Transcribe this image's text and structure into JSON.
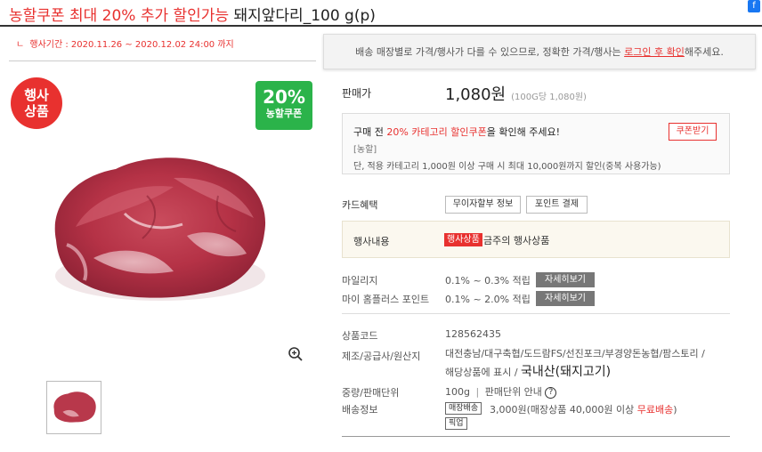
{
  "header": {
    "promo_text": "농할쿠폰 최대 20% 추가 할인가능",
    "product_name": "돼지앞다리_100 g(p)",
    "share_icon": "facebook-icon"
  },
  "period": {
    "bullet": "ㄴ",
    "text": "행사기간 : 2020.11.26 ~ 2020.12.02 24:00 까지"
  },
  "notice": {
    "text_before": "배송 매장별로 가격/행사가 다를 수 있으므로, 정확한 가격/행사는 ",
    "link": "로그인 후 확인",
    "text_after": "해주세요."
  },
  "badges": {
    "event_line1": "행사",
    "event_line2": "상품",
    "coupon_pct": "20%",
    "coupon_label": "농할쿠폰"
  },
  "gallery": {
    "zoom_icon": "zoom-in-icon"
  },
  "price": {
    "label": "판매가",
    "value": "1,080원",
    "unit": "(100G당 1,080원)"
  },
  "coupon": {
    "title_before": "구매 전 ",
    "title_red": "20% 카테고리 할인쿠폰",
    "title_after": "을 확인해 주세요!",
    "sub": "[농할]",
    "desc": "단, 적용 카테고리 1,000원 이상 구매 시 최대 10,000원까지 할인(중복 사용가능)",
    "button": "쿠폰받기"
  },
  "card": {
    "label": "카드혜택",
    "btn_installment": "무이자할부 정보",
    "btn_point": "포인트 결제"
  },
  "event": {
    "label": "행사내용",
    "tag": "행사상품",
    "text": "금주의 행사상품"
  },
  "points": {
    "mileage_label": "마일리지",
    "mileage_value": "0.1% ~ 0.3% 적립",
    "plus_label": "마이 홈플러스 포인트",
    "plus_value": "0.1% ~ 2.0% 적립",
    "detail_button": "자세히보기"
  },
  "info": {
    "code_label": "상품코드",
    "code_value": "128562435",
    "origin_label": "제조/공급사/원산지",
    "origin_line1": "대전충남/대구축협/도드람FS/선진포크/부경양돈농협/팜스토리 /",
    "origin_line2_small": "해당상품에 표시 / ",
    "origin_line2_big": "국내산(돼지고기)",
    "weight_label": "중량/판매단위",
    "weight_value": "100g",
    "weight_sep": "|",
    "unit_guide": "판매단위 안내",
    "help_icon": "question-icon",
    "delivery_label": "배송정보",
    "delivery_tag": "매장배송",
    "delivery_text_before": "3,000원(매장상품 40,000원 이상 ",
    "delivery_free": "무료배송",
    "delivery_text_after": ")",
    "pickup_tag": "픽업"
  }
}
